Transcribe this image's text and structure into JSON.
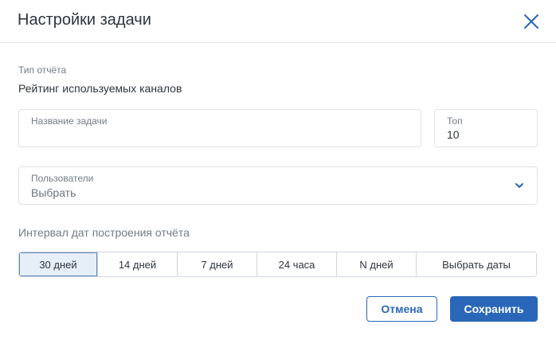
{
  "header": {
    "title": "Настройки задачи",
    "close_icon": "close-icon"
  },
  "report": {
    "label": "Тип отчёта",
    "value": "Рейтинг используемых каналов"
  },
  "task_name": {
    "label": "Название задачи",
    "value": ""
  },
  "top": {
    "label": "Топ",
    "value": "10"
  },
  "users": {
    "label": "Пользователи",
    "placeholder": "Выбрать",
    "icon": "chevron-down-icon"
  },
  "interval": {
    "label": "Интервал дат построения отчёта",
    "options": [
      {
        "label": "30 дней",
        "selected": true
      },
      {
        "label": "14 дней",
        "selected": false
      },
      {
        "label": "7 дней",
        "selected": false
      },
      {
        "label": "24 часа",
        "selected": false
      },
      {
        "label": "N дней",
        "selected": false
      },
      {
        "label": "Выбрать даты",
        "selected": false
      }
    ]
  },
  "actions": {
    "cancel_label": "Отмена",
    "save_label": "Сохранить"
  },
  "colors": {
    "accent": "#2a67b8",
    "selected_segment_bg": "#e6eef7"
  }
}
